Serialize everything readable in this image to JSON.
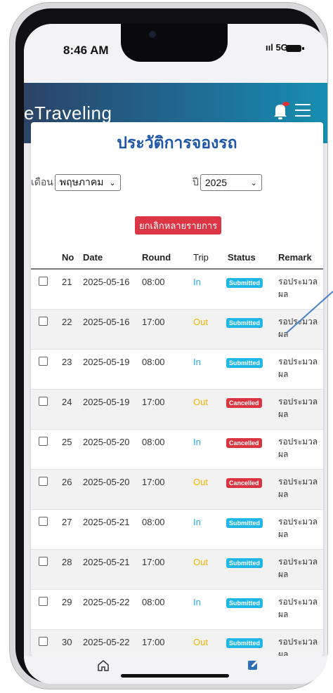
{
  "status_bar": {
    "time": "8:46 AM",
    "signal": "ııl 5G"
  },
  "app": {
    "brand": "eTraveling"
  },
  "page": {
    "title": "ประวัติการจองรถ",
    "month_label": "เดือน",
    "month_value": "พฤษภาคม",
    "year_label": "ปี",
    "year_value": "2025",
    "cancel_multiple_label": "ยกเลิกหลายรายการ"
  },
  "table": {
    "headers": {
      "no": "No",
      "date": "Date",
      "round": "Round",
      "trip": "Trip",
      "status": "Status",
      "remark": "Remark"
    },
    "rows": [
      {
        "no": "21",
        "date": "2025-05-16",
        "round": "08:00",
        "trip": "In",
        "status": "Submitted",
        "remark": "รอประมวลผล"
      },
      {
        "no": "22",
        "date": "2025-05-16",
        "round": "17:00",
        "trip": "Out",
        "status": "Submitted",
        "remark": "รอประมวลผล"
      },
      {
        "no": "23",
        "date": "2025-05-19",
        "round": "08:00",
        "trip": "In",
        "status": "Submitted",
        "remark": "รอประมวลผล"
      },
      {
        "no": "24",
        "date": "2025-05-19",
        "round": "17:00",
        "trip": "Out",
        "status": "Cancelled",
        "remark": "รอประมวลผล"
      },
      {
        "no": "25",
        "date": "2025-05-20",
        "round": "08:00",
        "trip": "In",
        "status": "Cancelled",
        "remark": "รอประมวลผล"
      },
      {
        "no": "26",
        "date": "2025-05-20",
        "round": "17:00",
        "trip": "Out",
        "status": "Cancelled",
        "remark": "รอประมวลผล"
      },
      {
        "no": "27",
        "date": "2025-05-21",
        "round": "08:00",
        "trip": "In",
        "status": "Submitted",
        "remark": "รอประมวลผล"
      },
      {
        "no": "28",
        "date": "2025-05-21",
        "round": "17:00",
        "trip": "Out",
        "status": "Submitted",
        "remark": "รอประมวลผล"
      },
      {
        "no": "29",
        "date": "2025-05-22",
        "round": "08:00",
        "trip": "In",
        "status": "Submitted",
        "remark": "รอประมวลผล"
      },
      {
        "no": "30",
        "date": "2025-05-22",
        "round": "17:00",
        "trip": "Out",
        "status": "Submitted",
        "remark": "รอประมวลผล"
      }
    ]
  },
  "colors": {
    "submitted": "#1fb8e6",
    "cancelled": "#d9343f",
    "trip_in": "#22a7e0",
    "trip_out": "#f2b300",
    "title": "#1f57a6"
  },
  "nav": {
    "home_icon": "home-icon",
    "edit_icon": "edit-icon"
  }
}
